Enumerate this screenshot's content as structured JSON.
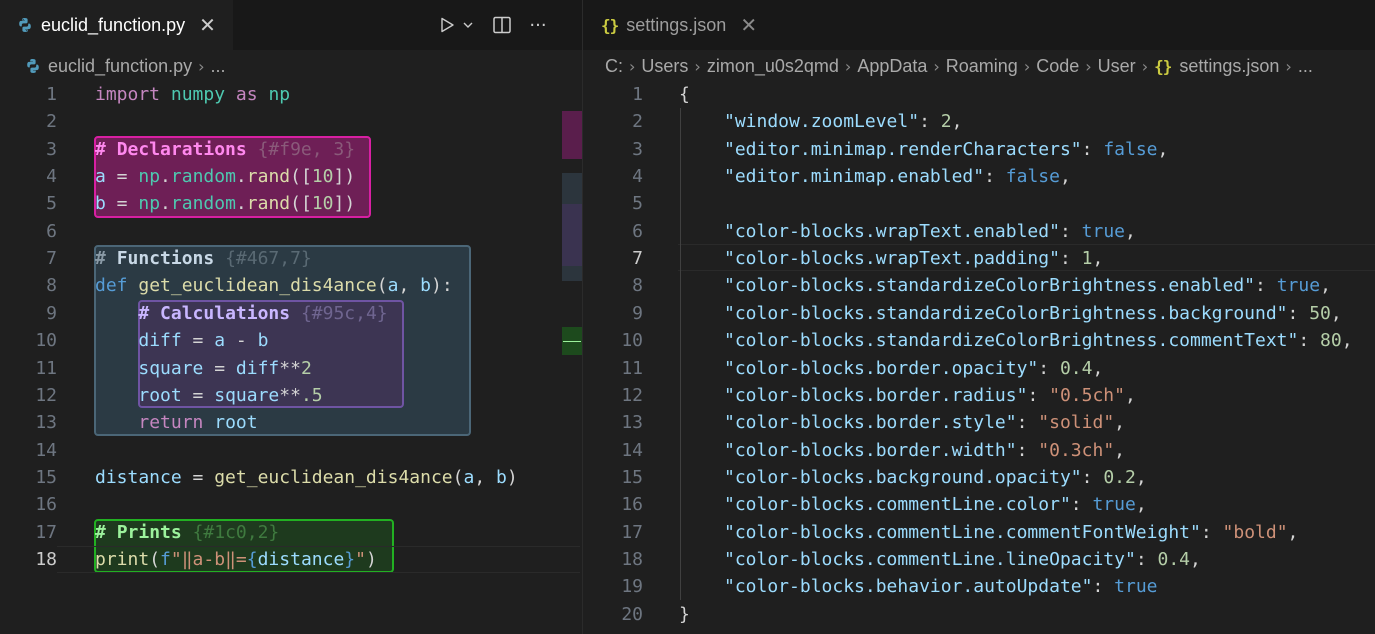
{
  "left": {
    "tab": {
      "label": "euclid_function.py",
      "close": "✕",
      "icon": "python-file-icon"
    },
    "actions": {
      "run": "▷",
      "run_dropdown": "⌄",
      "split": "split-editor-icon",
      "more": "···"
    },
    "breadcrumb": {
      "file": "euclid_function.py",
      "sep": "›",
      "more": "..."
    },
    "current_line": 18,
    "line_numbers": [
      "1",
      "2",
      "3",
      "4",
      "5",
      "6",
      "7",
      "8",
      "9",
      "10",
      "11",
      "12",
      "13",
      "14",
      "15",
      "16",
      "17",
      "18"
    ],
    "code": {
      "l1": {
        "import": "import",
        "module": "numpy",
        "as": "as",
        "alias": "np"
      },
      "l3": {
        "hash": "#",
        "title": "Declarations",
        "meta": "{#f9e, 3}"
      },
      "l4": {
        "var": "a",
        "eq": " = ",
        "obj": "np",
        "dot": ".",
        "attr": "random",
        "dot2": ".",
        "fn": "rand",
        "open": "([",
        "num": "10",
        "close": "])"
      },
      "l5": {
        "var": "b",
        "eq": " = ",
        "obj": "np",
        "dot": ".",
        "attr": "random",
        "dot2": ".",
        "fn": "rand",
        "open": "([",
        "num": "10",
        "close": "])"
      },
      "l7": {
        "hash": "#",
        "title": "Functions",
        "meta": "{#467,7}"
      },
      "l8": {
        "def": "def",
        "fn": "get_euclidean_dis4ance",
        "open": "(",
        "a": "a",
        "comma": ", ",
        "b": "b",
        "close": "):"
      },
      "l9": {
        "hash": "#",
        "title": "Calculations",
        "meta": "{#95c,4}"
      },
      "l10": {
        "var": "diff",
        "eq": " = ",
        "a": "a",
        "op": " - ",
        "b": "b"
      },
      "l11": {
        "var": "square",
        "eq": " = ",
        "a": "diff",
        "op": "**",
        "num": "2"
      },
      "l12": {
        "var": "root",
        "eq": " = ",
        "a": "square",
        "op": "**",
        "num": ".5"
      },
      "l13": {
        "ret": "return",
        "var": "root"
      },
      "l15": {
        "var": "distance",
        "eq": " = ",
        "fn": "get_euclidean_dis4ance",
        "open": "(",
        "a": "a",
        "comma": ", ",
        "b": "b",
        "close": ")"
      },
      "l17": {
        "hash": "#",
        "title": "Prints",
        "meta": "{#1c0,2}"
      },
      "l18": {
        "fn": "print",
        "open": "(",
        "f": "f",
        "q1": "\"",
        "s1": "‖a-b‖=",
        "lb": "{",
        "var": "distance",
        "rb": "}",
        "q2": "\"",
        "close": ")"
      }
    },
    "blocks": {
      "declarations": {
        "bg": "#6e1f56",
        "border": "#d81fa3"
      },
      "functions": {
        "bg": "#2b3a44",
        "border": "#4b6677"
      },
      "calculations": {
        "bg": "#3d3553",
        "border": "#6f54a3"
      },
      "prints": {
        "bg": "#1e3a1e",
        "border": "#22b022"
      }
    },
    "comment_colors": {
      "declarations": "#ff88ee",
      "functions": "#c8d8e6",
      "calculations": "#c9b6ff",
      "prints": "#9cf29c"
    }
  },
  "right": {
    "tab": {
      "label": "settings.json",
      "close": "✕",
      "icon": "{}"
    },
    "breadcrumb": [
      "C:",
      "Users",
      "zimon_u0s2qmd",
      "AppData",
      "Roaming",
      "Code",
      "User"
    ],
    "breadcrumb_file": "settings.json",
    "breadcrumb_more": "...",
    "breadcrumb_sep": "›",
    "current_line": 7,
    "line_numbers": [
      "1",
      "2",
      "3",
      "4",
      "5",
      "6",
      "7",
      "8",
      "9",
      "10",
      "11",
      "12",
      "13",
      "14",
      "15",
      "16",
      "17",
      "18",
      "19",
      "20"
    ],
    "open_brace": "{",
    "close_brace": "}",
    "settings": [
      {
        "key": "\"window.zoomLevel\"",
        "value": "2",
        "kind": "num"
      },
      {
        "key": "\"editor.minimap.renderCharacters\"",
        "value": "false",
        "kind": "bool"
      },
      {
        "key": "\"editor.minimap.enabled\"",
        "value": "false",
        "kind": "bool"
      },
      null,
      {
        "key": "\"color-blocks.wrapText.enabled\"",
        "value": "true",
        "kind": "bool"
      },
      {
        "key": "\"color-blocks.wrapText.padding\"",
        "value": "1",
        "kind": "num"
      },
      {
        "key": "\"color-blocks.standardizeColorBrightness.enabled\"",
        "value": "true",
        "kind": "bool"
      },
      {
        "key": "\"color-blocks.standardizeColorBrightness.background\"",
        "value": "50",
        "kind": "num"
      },
      {
        "key": "\"color-blocks.standardizeColorBrightness.commentText\"",
        "value": "80",
        "kind": "num"
      },
      {
        "key": "\"color-blocks.border.opacity\"",
        "value": "0.4",
        "kind": "num"
      },
      {
        "key": "\"color-blocks.border.radius\"",
        "value": "\"0.5ch\"",
        "kind": "str"
      },
      {
        "key": "\"color-blocks.border.style\"",
        "value": "\"solid\"",
        "kind": "str"
      },
      {
        "key": "\"color-blocks.border.width\"",
        "value": "\"0.3ch\"",
        "kind": "str"
      },
      {
        "key": "\"color-blocks.background.opacity\"",
        "value": "0.2",
        "kind": "num"
      },
      {
        "key": "\"color-blocks.commentLine.color\"",
        "value": "true",
        "kind": "bool"
      },
      {
        "key": "\"color-blocks.commentLine.commentFontWeight\"",
        "value": "\"bold\"",
        "kind": "str"
      },
      {
        "key": "\"color-blocks.commentLine.lineOpacity\"",
        "value": "0.4",
        "kind": "num"
      },
      {
        "key": "\"color-blocks.behavior.autoUpdate\"",
        "value": "true",
        "kind": "bool",
        "last": true
      }
    ]
  }
}
